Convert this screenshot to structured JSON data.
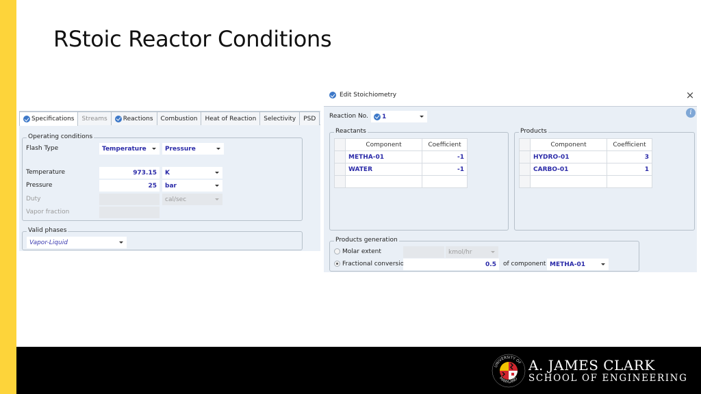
{
  "slide": {
    "title": "RStoic Reactor Conditions",
    "accent_color": "#fdd43a",
    "footer": {
      "logo_line1": "A. JAMES CLARK",
      "logo_line2": "SCHOOL OF ENGINEERING",
      "seal_top_text": "UNIVERSITY OF",
      "seal_bottom_text": "MARYLAND"
    }
  },
  "spec_panel": {
    "tabs": [
      {
        "label": "Specifications",
        "icon": "check-circle-icon",
        "state": "active"
      },
      {
        "label": "Streams",
        "icon": "",
        "state": "disabled"
      },
      {
        "label": "Reactions",
        "icon": "check-circle-icon",
        "state": "normal"
      },
      {
        "label": "Combustion",
        "icon": "",
        "state": "normal"
      },
      {
        "label": "Heat of Reaction",
        "icon": "",
        "state": "normal"
      },
      {
        "label": "Selectivity",
        "icon": "",
        "state": "normal"
      },
      {
        "label": "PSD",
        "icon": "",
        "state": "normal"
      }
    ],
    "operating_conditions": {
      "group_label": "Operating conditions",
      "flash_type_label": "Flash Type",
      "flash_type_1": "Temperature",
      "flash_type_2": "Pressure",
      "temperature_label": "Temperature",
      "temperature_value": "973.15",
      "temperature_unit": "K",
      "pressure_label": "Pressure",
      "pressure_value": "25",
      "pressure_unit": "bar",
      "duty_label": "Duty",
      "duty_value": "",
      "duty_unit": "cal/sec",
      "vapor_fraction_label": "Vapor fraction",
      "vapor_fraction_value": ""
    },
    "valid_phases": {
      "group_label": "Valid phases",
      "value": "Vapor-Liquid"
    }
  },
  "stoich_dialog": {
    "title": "Edit Stoichiometry",
    "close_label": "×",
    "info_label": "i",
    "reaction_no_label": "Reaction No.",
    "reaction_no_value": "1",
    "reactants": {
      "group_label": "Reactants",
      "headers": [
        "Component",
        "Coefficient"
      ],
      "rows": [
        {
          "component": "METHA-01",
          "coefficient": "-1"
        },
        {
          "component": "WATER",
          "coefficient": "-1"
        },
        {
          "component": "",
          "coefficient": ""
        }
      ]
    },
    "products": {
      "group_label": "Products",
      "headers": [
        "Component",
        "Coefficient"
      ],
      "rows": [
        {
          "component": "HYDRO-01",
          "coefficient": "3"
        },
        {
          "component": "CARBO-01",
          "coefficient": "1"
        },
        {
          "component": "",
          "coefficient": ""
        }
      ]
    },
    "products_generation": {
      "group_label": "Products generation",
      "molar_extent_label": "Molar extent",
      "molar_extent_value": "",
      "molar_extent_unit": "kmol/hr",
      "fractional_conversion_label": "Fractional conversion",
      "fractional_conversion_value": "0.5",
      "of_component_label": "of component",
      "component_value": "METHA-01",
      "selected_option": "Fractional conversion"
    }
  }
}
